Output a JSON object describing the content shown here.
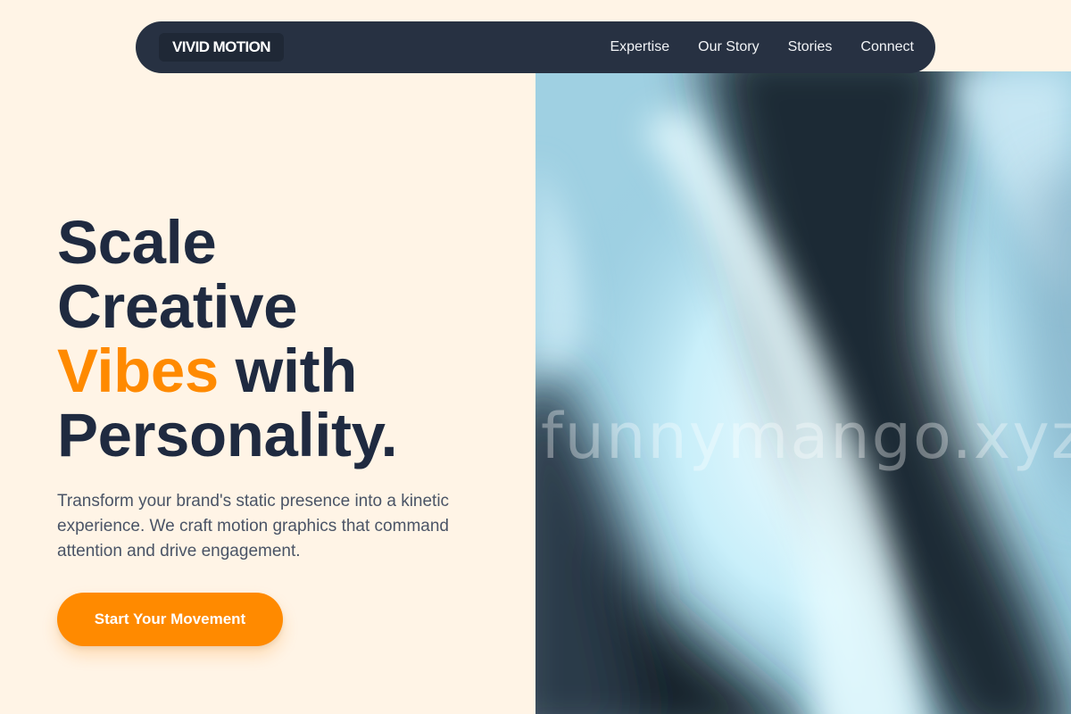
{
  "nav": {
    "logo": "VIVID MOTION",
    "links": [
      {
        "label": "Expertise"
      },
      {
        "label": "Our Story"
      },
      {
        "label": "Stories"
      },
      {
        "label": "Connect"
      }
    ]
  },
  "hero": {
    "headline": {
      "line1": "Scale",
      "line2": "Creative",
      "accent": "Vibes",
      "line3_rest": " with",
      "line4": "Personality."
    },
    "description": "Transform your brand's static presence into a kinetic experience. We craft motion graphics that command attention and drive engagement.",
    "cta_label": "Start Your Movement",
    "image_watermark": "funnymango.xyz"
  },
  "colors": {
    "background": "#fff4e6",
    "nav": "#273142",
    "accent": "#ff8a00",
    "heading": "#1f2a40"
  }
}
